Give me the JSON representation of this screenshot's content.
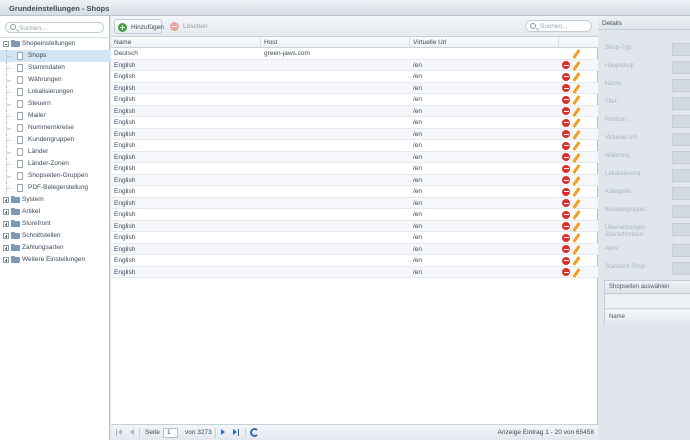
{
  "window": {
    "title": "Grundeinstellungen - Shops"
  },
  "tree": {
    "search_placeholder": "Suchen...",
    "nodes": [
      {
        "label": "Shopeinstellungen",
        "type": "folder",
        "expanded": true,
        "level": 0
      },
      {
        "label": "Shops",
        "type": "leaf",
        "level": 1,
        "selected": true
      },
      {
        "label": "Stammdaten",
        "type": "leaf",
        "level": 1
      },
      {
        "label": "Währungen",
        "type": "leaf",
        "level": 1
      },
      {
        "label": "Lokalisierungen",
        "type": "leaf",
        "level": 1
      },
      {
        "label": "Steuern",
        "type": "leaf",
        "level": 1
      },
      {
        "label": "Mailer",
        "type": "leaf",
        "level": 1
      },
      {
        "label": "Nummernkreise",
        "type": "leaf",
        "level": 1
      },
      {
        "label": "Kundengruppen",
        "type": "leaf",
        "level": 1
      },
      {
        "label": "Länder",
        "type": "leaf",
        "level": 1
      },
      {
        "label": "Länder-Zonen",
        "type": "leaf",
        "level": 1
      },
      {
        "label": "Shopseiten-Gruppen",
        "type": "leaf",
        "level": 1
      },
      {
        "label": "PDF-Belegerstellung",
        "type": "leaf",
        "level": 1
      },
      {
        "label": "System",
        "type": "folder",
        "expanded": false,
        "level": 0
      },
      {
        "label": "Artikel",
        "type": "folder",
        "expanded": false,
        "level": 0
      },
      {
        "label": "Storefront",
        "type": "folder",
        "expanded": false,
        "level": 0
      },
      {
        "label": "Schnittstellen",
        "type": "folder",
        "expanded": false,
        "level": 0
      },
      {
        "label": "Zahlungsarten",
        "type": "folder",
        "expanded": false,
        "level": 0
      },
      {
        "label": "Weitere Einstellungen",
        "type": "folder",
        "expanded": false,
        "level": 0
      }
    ]
  },
  "toolbar": {
    "add_label": "Hinzufügen",
    "delete_label": "Löschen",
    "search_placeholder": "Suchen..."
  },
  "grid": {
    "columns": [
      "Name",
      "Host",
      "Virtuelle Url"
    ],
    "rows": [
      {
        "name": "Deutsch",
        "host": "green-jaws.com",
        "url": "",
        "deletable": false
      },
      {
        "name": "English",
        "host": "",
        "url": "/en",
        "deletable": true
      },
      {
        "name": "English",
        "host": "",
        "url": "/en",
        "deletable": true
      },
      {
        "name": "English",
        "host": "",
        "url": "/en",
        "deletable": true
      },
      {
        "name": "English",
        "host": "",
        "url": "/en",
        "deletable": true
      },
      {
        "name": "English",
        "host": "",
        "url": "/en",
        "deletable": true
      },
      {
        "name": "English",
        "host": "",
        "url": "/en",
        "deletable": true
      },
      {
        "name": "English",
        "host": "",
        "url": "/en",
        "deletable": true
      },
      {
        "name": "English",
        "host": "",
        "url": "/en",
        "deletable": true
      },
      {
        "name": "English",
        "host": "",
        "url": "/en",
        "deletable": true
      },
      {
        "name": "English",
        "host": "",
        "url": "/en",
        "deletable": true
      },
      {
        "name": "English",
        "host": "",
        "url": "/en",
        "deletable": true
      },
      {
        "name": "English",
        "host": "",
        "url": "/en",
        "deletable": true
      },
      {
        "name": "English",
        "host": "",
        "url": "/en",
        "deletable": true
      },
      {
        "name": "English",
        "host": "",
        "url": "/en",
        "deletable": true
      },
      {
        "name": "English",
        "host": "",
        "url": "/en",
        "deletable": true
      },
      {
        "name": "English",
        "host": "",
        "url": "/en",
        "deletable": true
      },
      {
        "name": "English",
        "host": "",
        "url": "/en",
        "deletable": true
      },
      {
        "name": "English",
        "host": "",
        "url": "/en",
        "deletable": true
      },
      {
        "name": "English",
        "host": "",
        "url": "/en",
        "deletable": true
      }
    ]
  },
  "pager": {
    "page_label": "Seite",
    "page_value": "1",
    "of_label": "von 3273",
    "display_info": "Anzeige Eintrag 1 - 20 von 65458"
  },
  "detail": {
    "title": "Details",
    "fields": [
      "Shop-Typ:",
      "Hauptshop:",
      "Name:",
      "Titel:",
      "Position:",
      "Virtuelle Url:",
      "Währung:",
      "Lokalisierung:",
      "Kategorie:",
      "Kundengruppe:",
      "Übersetzungen überschreiben:",
      "Aktiv:",
      "Standard-Shop:"
    ],
    "subgrid_title": "Shopseiten auswählen",
    "subgrid_column": "Name"
  },
  "colors": {
    "selection": "#d3e4f5",
    "accent": "#2a6fb7",
    "delete_red": "#d9302c",
    "edit_orange": "#f0a01c",
    "add_green": "#3fa23f"
  }
}
